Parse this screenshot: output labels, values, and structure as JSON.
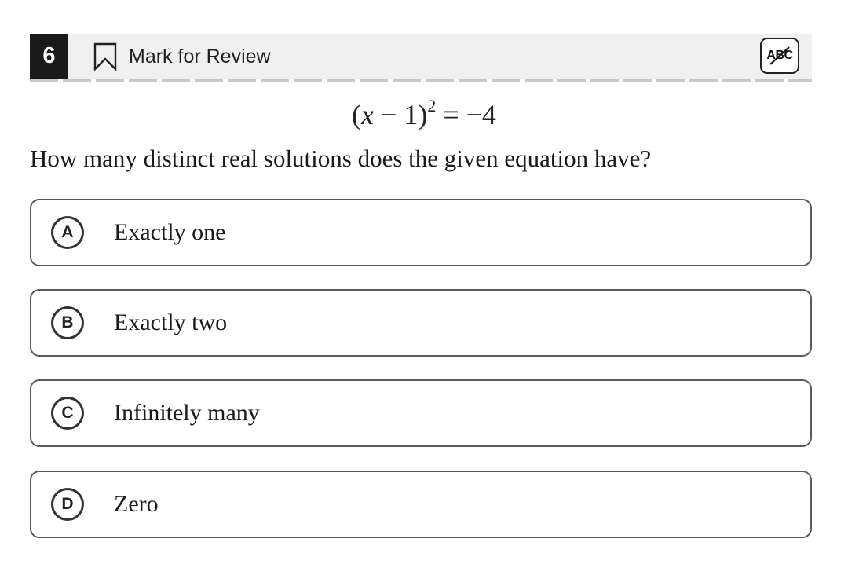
{
  "header": {
    "question_number": "6",
    "mark_for_review_label": "Mark for Review",
    "abc_label": "ABC"
  },
  "equation": {
    "lhs_open": "(",
    "variable": "x",
    "lhs_rest": " − 1)",
    "exponent": "2",
    "rhs": " = −4"
  },
  "question_text": "How many distinct real solutions does the given equation have?",
  "choices": [
    {
      "letter": "A",
      "text": "Exactly one"
    },
    {
      "letter": "B",
      "text": "Exactly two"
    },
    {
      "letter": "C",
      "text": "Infinitely many"
    },
    {
      "letter": "D",
      "text": "Zero"
    }
  ]
}
